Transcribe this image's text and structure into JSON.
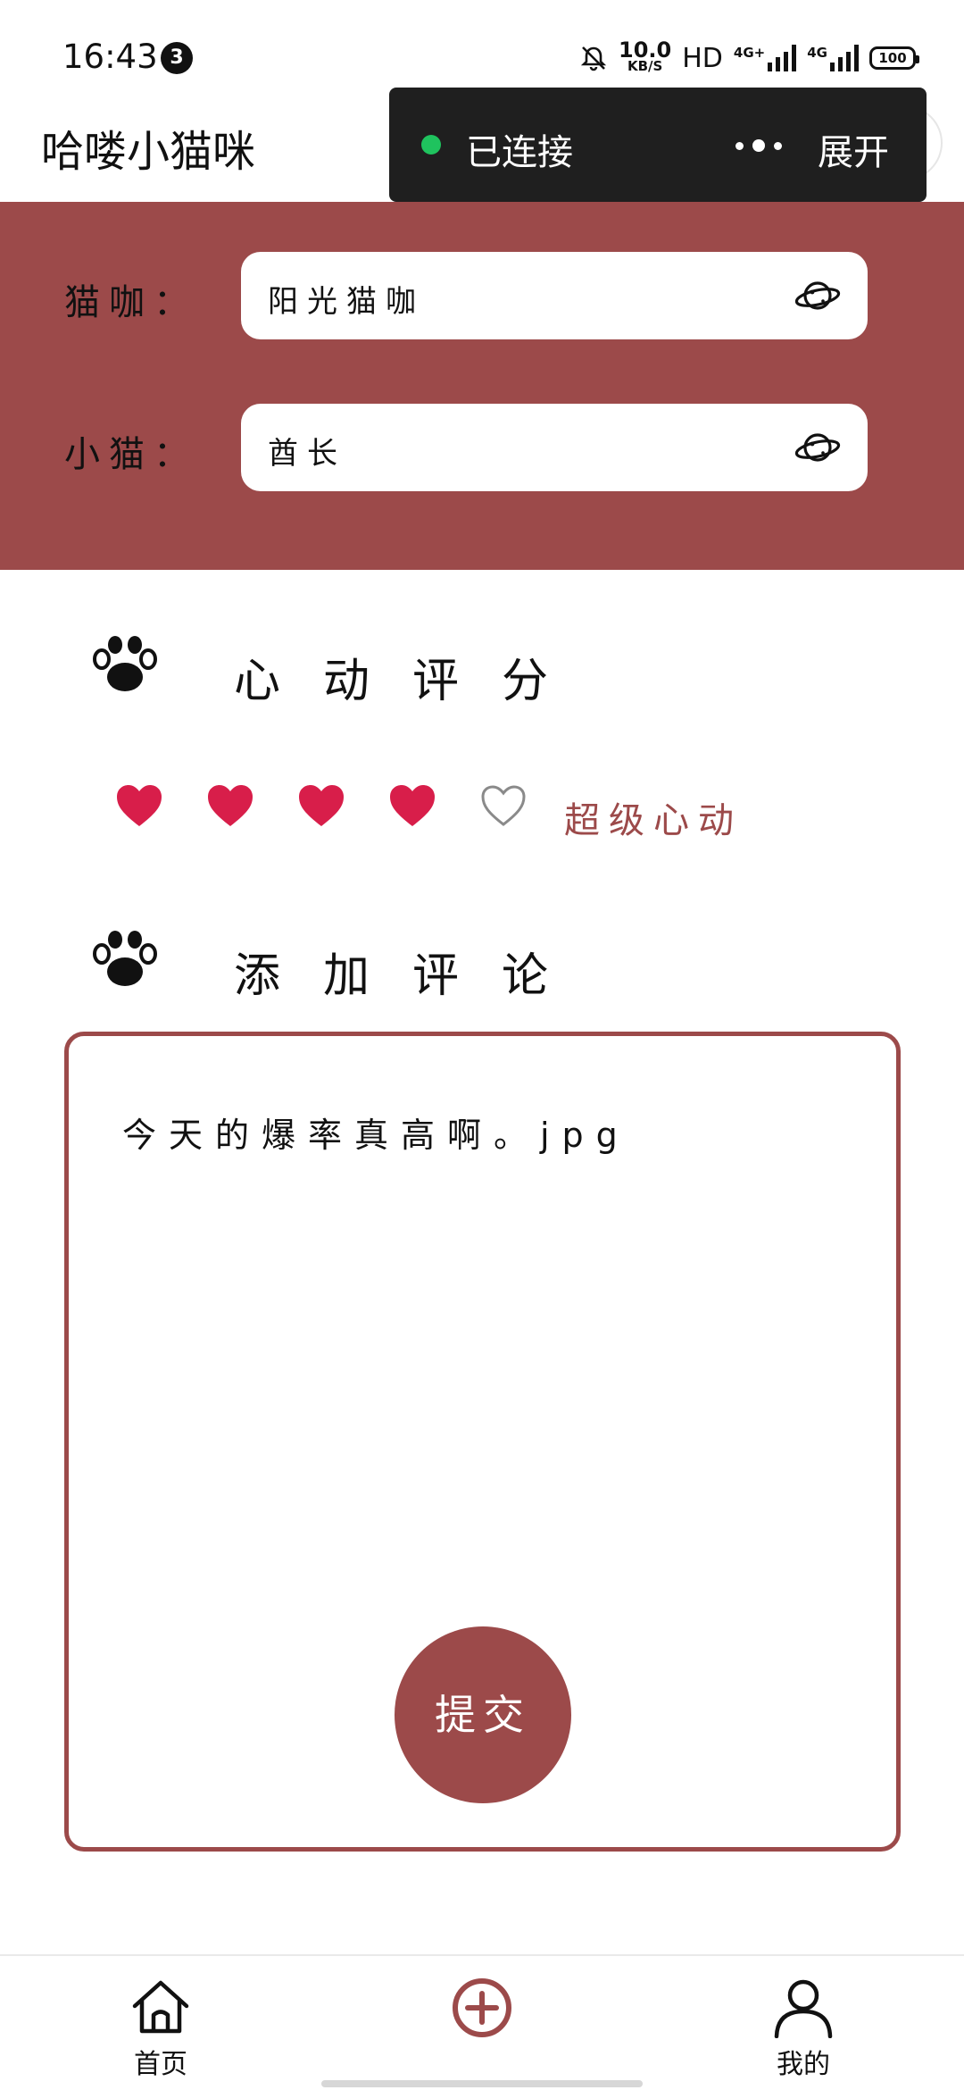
{
  "status_bar": {
    "time": "16:43",
    "notification_count": "3",
    "net_speed_value": "10.0",
    "net_speed_unit": "KB/S",
    "hd_label": "HD",
    "sim1_label": "4G+",
    "sim2_label": "4G",
    "battery": "100"
  },
  "app": {
    "title": "哈喽小猫咪"
  },
  "toast": {
    "status": "已连接",
    "expand_label": "展开",
    "status_color": "#1fc35e"
  },
  "form": {
    "cafe_label": "猫咖：",
    "cafe_value": "阳光猫咖",
    "cat_label": "小猫：",
    "cat_value": "酋长"
  },
  "rating": {
    "title": "心动评分",
    "score": 4,
    "max": 5,
    "level_text": "超级心动",
    "filled_color": "#d81e4a"
  },
  "comment": {
    "title": "添加评论",
    "text": "今天的爆率真高啊。jpg"
  },
  "submit_label": "提交",
  "tabbar": {
    "home_label": "首页",
    "mine_label": "我的"
  },
  "theme": {
    "accent": "#9c4a4a"
  }
}
